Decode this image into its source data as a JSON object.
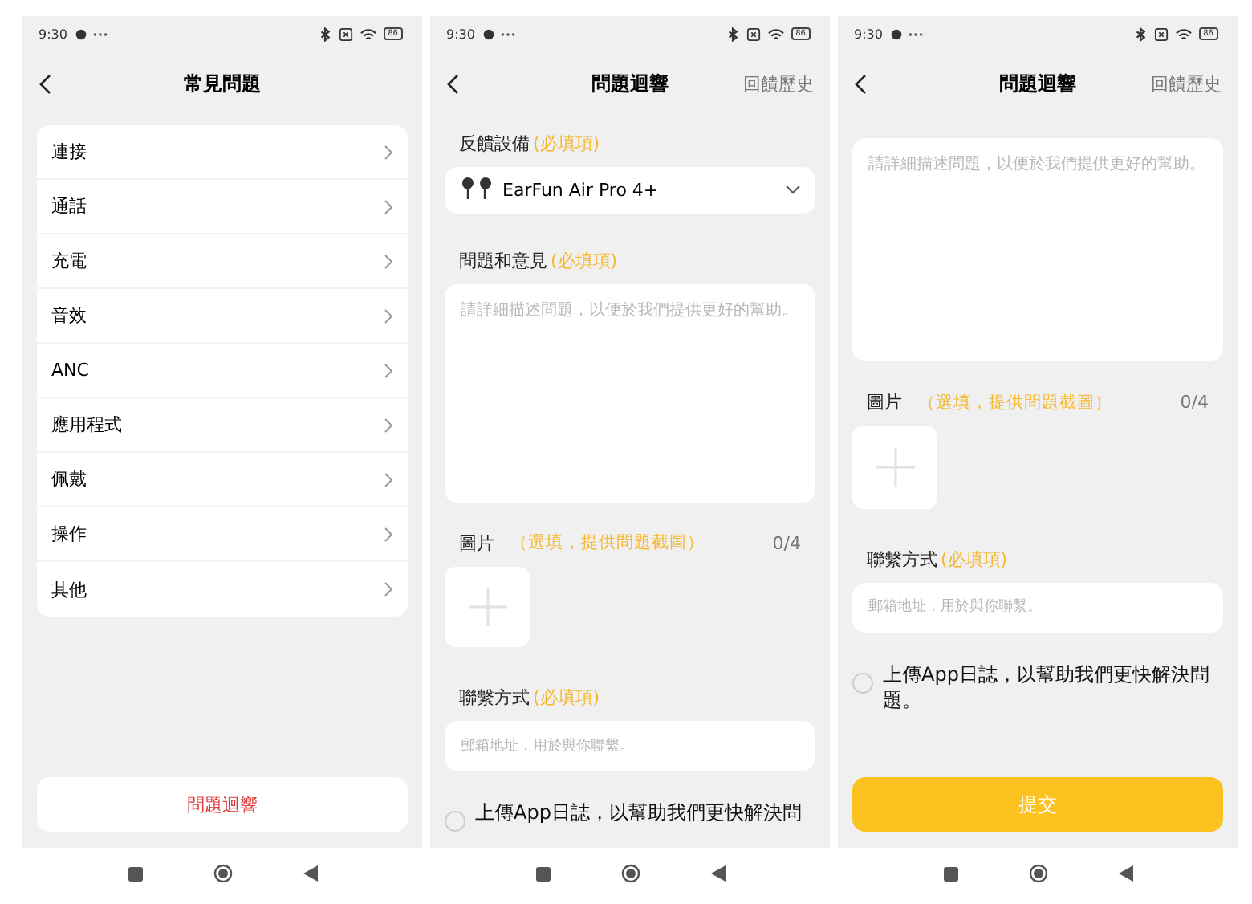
{
  "screens": [
    {
      "kind": "faq",
      "time": "9:30",
      "battery": "86",
      "title": "常見問題",
      "items": [
        "連接",
        "通話",
        "充電",
        "音效",
        "ANC",
        "應用程式",
        "佩戴",
        "操作",
        "其他"
      ],
      "footer_button": "問題迴響"
    },
    {
      "kind": "feedback",
      "time": "9:30",
      "battery": "86",
      "title": "問題迴響",
      "history_link": "回饋歷史",
      "sections": [
        {
          "kind": "device",
          "label": "反饋設備",
          "required": "(必填項)",
          "value": "EarFun Air Pro 4+"
        },
        {
          "kind": "description",
          "label": "問題和意見",
          "required": "(必填項)",
          "placeholder": "請詳細描述問題，以便於我們提供更好的幫助。"
        },
        {
          "kind": "images",
          "label": "圖片",
          "hint": "（選填，提供問題截圖）",
          "count": "0/4"
        },
        {
          "kind": "contact",
          "label": "聯繫方式",
          "required": "(必填項)",
          "placeholder": "郵箱地址，用於與你聯繫。"
        },
        {
          "kind": "log",
          "text": "上傳App日誌，以幫助我們更快解決問",
          "checked": false
        }
      ]
    },
    {
      "kind": "feedback",
      "time": "9:30",
      "battery": "86",
      "title": "問題迴響",
      "history_link": "回饋歷史",
      "sections": [
        {
          "kind": "description",
          "placeholder": "請詳細描述問題，以便於我們提供更好的幫助。"
        },
        {
          "kind": "images",
          "label": "圖片",
          "hint": "（選填，提供問題截圖）",
          "count": "0/4"
        },
        {
          "kind": "contact",
          "label": "聯繫方式",
          "required": "(必填項)",
          "placeholder": "郵箱地址，用於與你聯繫。"
        },
        {
          "kind": "log",
          "text": "上傳App日誌，以幫助我們更快解決問題。",
          "checked": false
        },
        {
          "kind": "submit",
          "label": "提交"
        }
      ]
    }
  ]
}
